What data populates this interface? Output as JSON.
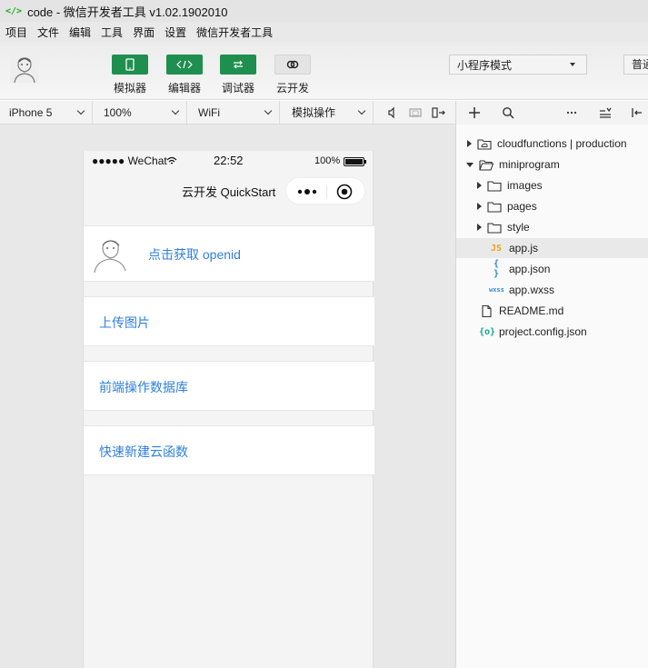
{
  "window": {
    "title": "code - 微信开发者工具 v1.02.1902010",
    "logo": "</>"
  },
  "menu": [
    "项目",
    "文件",
    "编辑",
    "工具",
    "界面",
    "设置",
    "微信开发者工具"
  ],
  "toolbar": {
    "simulator_label": "模拟器",
    "editor_label": "编辑器",
    "debugger_label": "调试器",
    "cloud_label": "云开发",
    "mode": "小程序模式",
    "compile_label": "普通"
  },
  "subtoolbar": {
    "device": "iPhone 5",
    "zoom": "100%",
    "network": "WiFi",
    "operation": "模拟操作"
  },
  "phone": {
    "status_left": "●●●●● WeChat",
    "time": "22:52",
    "battery": "100%",
    "nav_title": "云开发 QuickStart",
    "openid_label": "点击获取 openid",
    "upload_label": "上传图片",
    "db_label": "前端操作数据库",
    "function_label": "快速新建云函数"
  },
  "tree": {
    "items": [
      {
        "label": "cloudfunctions | production",
        "type": "cloud-folder"
      },
      {
        "label": "miniprogram",
        "type": "folder-open"
      },
      {
        "label": "images",
        "type": "folder"
      },
      {
        "label": "pages",
        "type": "folder"
      },
      {
        "label": "style",
        "type": "folder"
      },
      {
        "label": "app.js",
        "type": "js",
        "badge": "JS"
      },
      {
        "label": "app.json",
        "type": "json",
        "badge": "{ }"
      },
      {
        "label": "app.wxss",
        "type": "wxss",
        "badge": "wxss"
      },
      {
        "label": "README.md",
        "type": "file"
      },
      {
        "label": "project.config.json",
        "type": "config",
        "badge": "{o}"
      }
    ]
  },
  "colors": {
    "accent_green": "#1e8f4f",
    "link_blue": "#2e7fe0",
    "js_yellow": "#e8a317",
    "json_blue": "#2a8ad8",
    "config_green": "#17a589"
  }
}
